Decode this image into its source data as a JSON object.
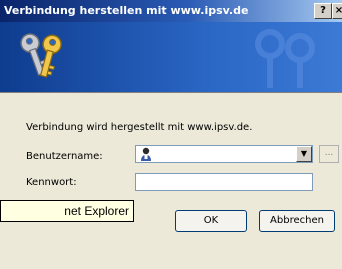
{
  "titlebar": {
    "title": "Verbindung herstellen mit www.ipsv.de",
    "help_label": "?",
    "close_label": "×"
  },
  "banner": {
    "icon": "keys-icon"
  },
  "form": {
    "info_text": "Verbindung wird hergestellt mit www.ipsv.de.",
    "username_label": "Benutzername:",
    "username_value": "",
    "password_label": "Kennwort:",
    "password_value": "",
    "dropdown_arrow": "▼",
    "browse_label": "..."
  },
  "buttons": {
    "ok": "OK",
    "cancel": "Abbrechen"
  },
  "tooltip": {
    "text": "net Explorer"
  }
}
